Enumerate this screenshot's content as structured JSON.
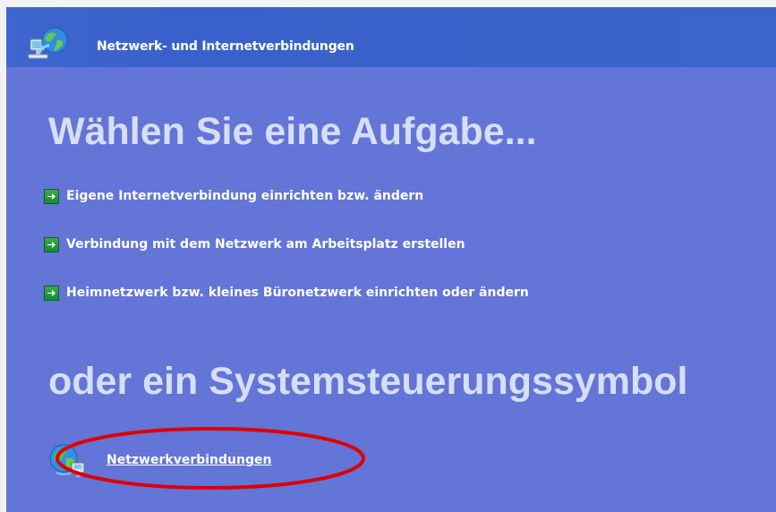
{
  "header": {
    "title": "Netzwerk- und Internetverbindungen",
    "icon": "network-globe-icon"
  },
  "main": {
    "task_heading": "Wählen Sie eine Aufgabe...",
    "tasks": [
      {
        "label": "Eigene Internetverbindung einrichten bzw. ändern",
        "icon": "green-arrow-icon"
      },
      {
        "label": "Verbindung mit dem Netzwerk am Arbeitsplatz erstellen",
        "icon": "green-arrow-icon"
      },
      {
        "label": "Heimnetzwerk bzw. kleines Büronetzwerk einrichten oder ändern",
        "icon": "green-arrow-icon"
      }
    ],
    "control_panel_heading": "oder ein Systemsteuerungssymbol",
    "control_panel_items": [
      {
        "label": "Netzwerkverbindungen",
        "icon": "network-connections-icon"
      }
    ]
  },
  "colors": {
    "panel_background": "#6375d6",
    "header_background": "#3d63cc",
    "heading_text": "#d7def8",
    "task_text": "#ffffff",
    "highlight": "#e00000",
    "arrow_green": "#1d9a3a"
  }
}
